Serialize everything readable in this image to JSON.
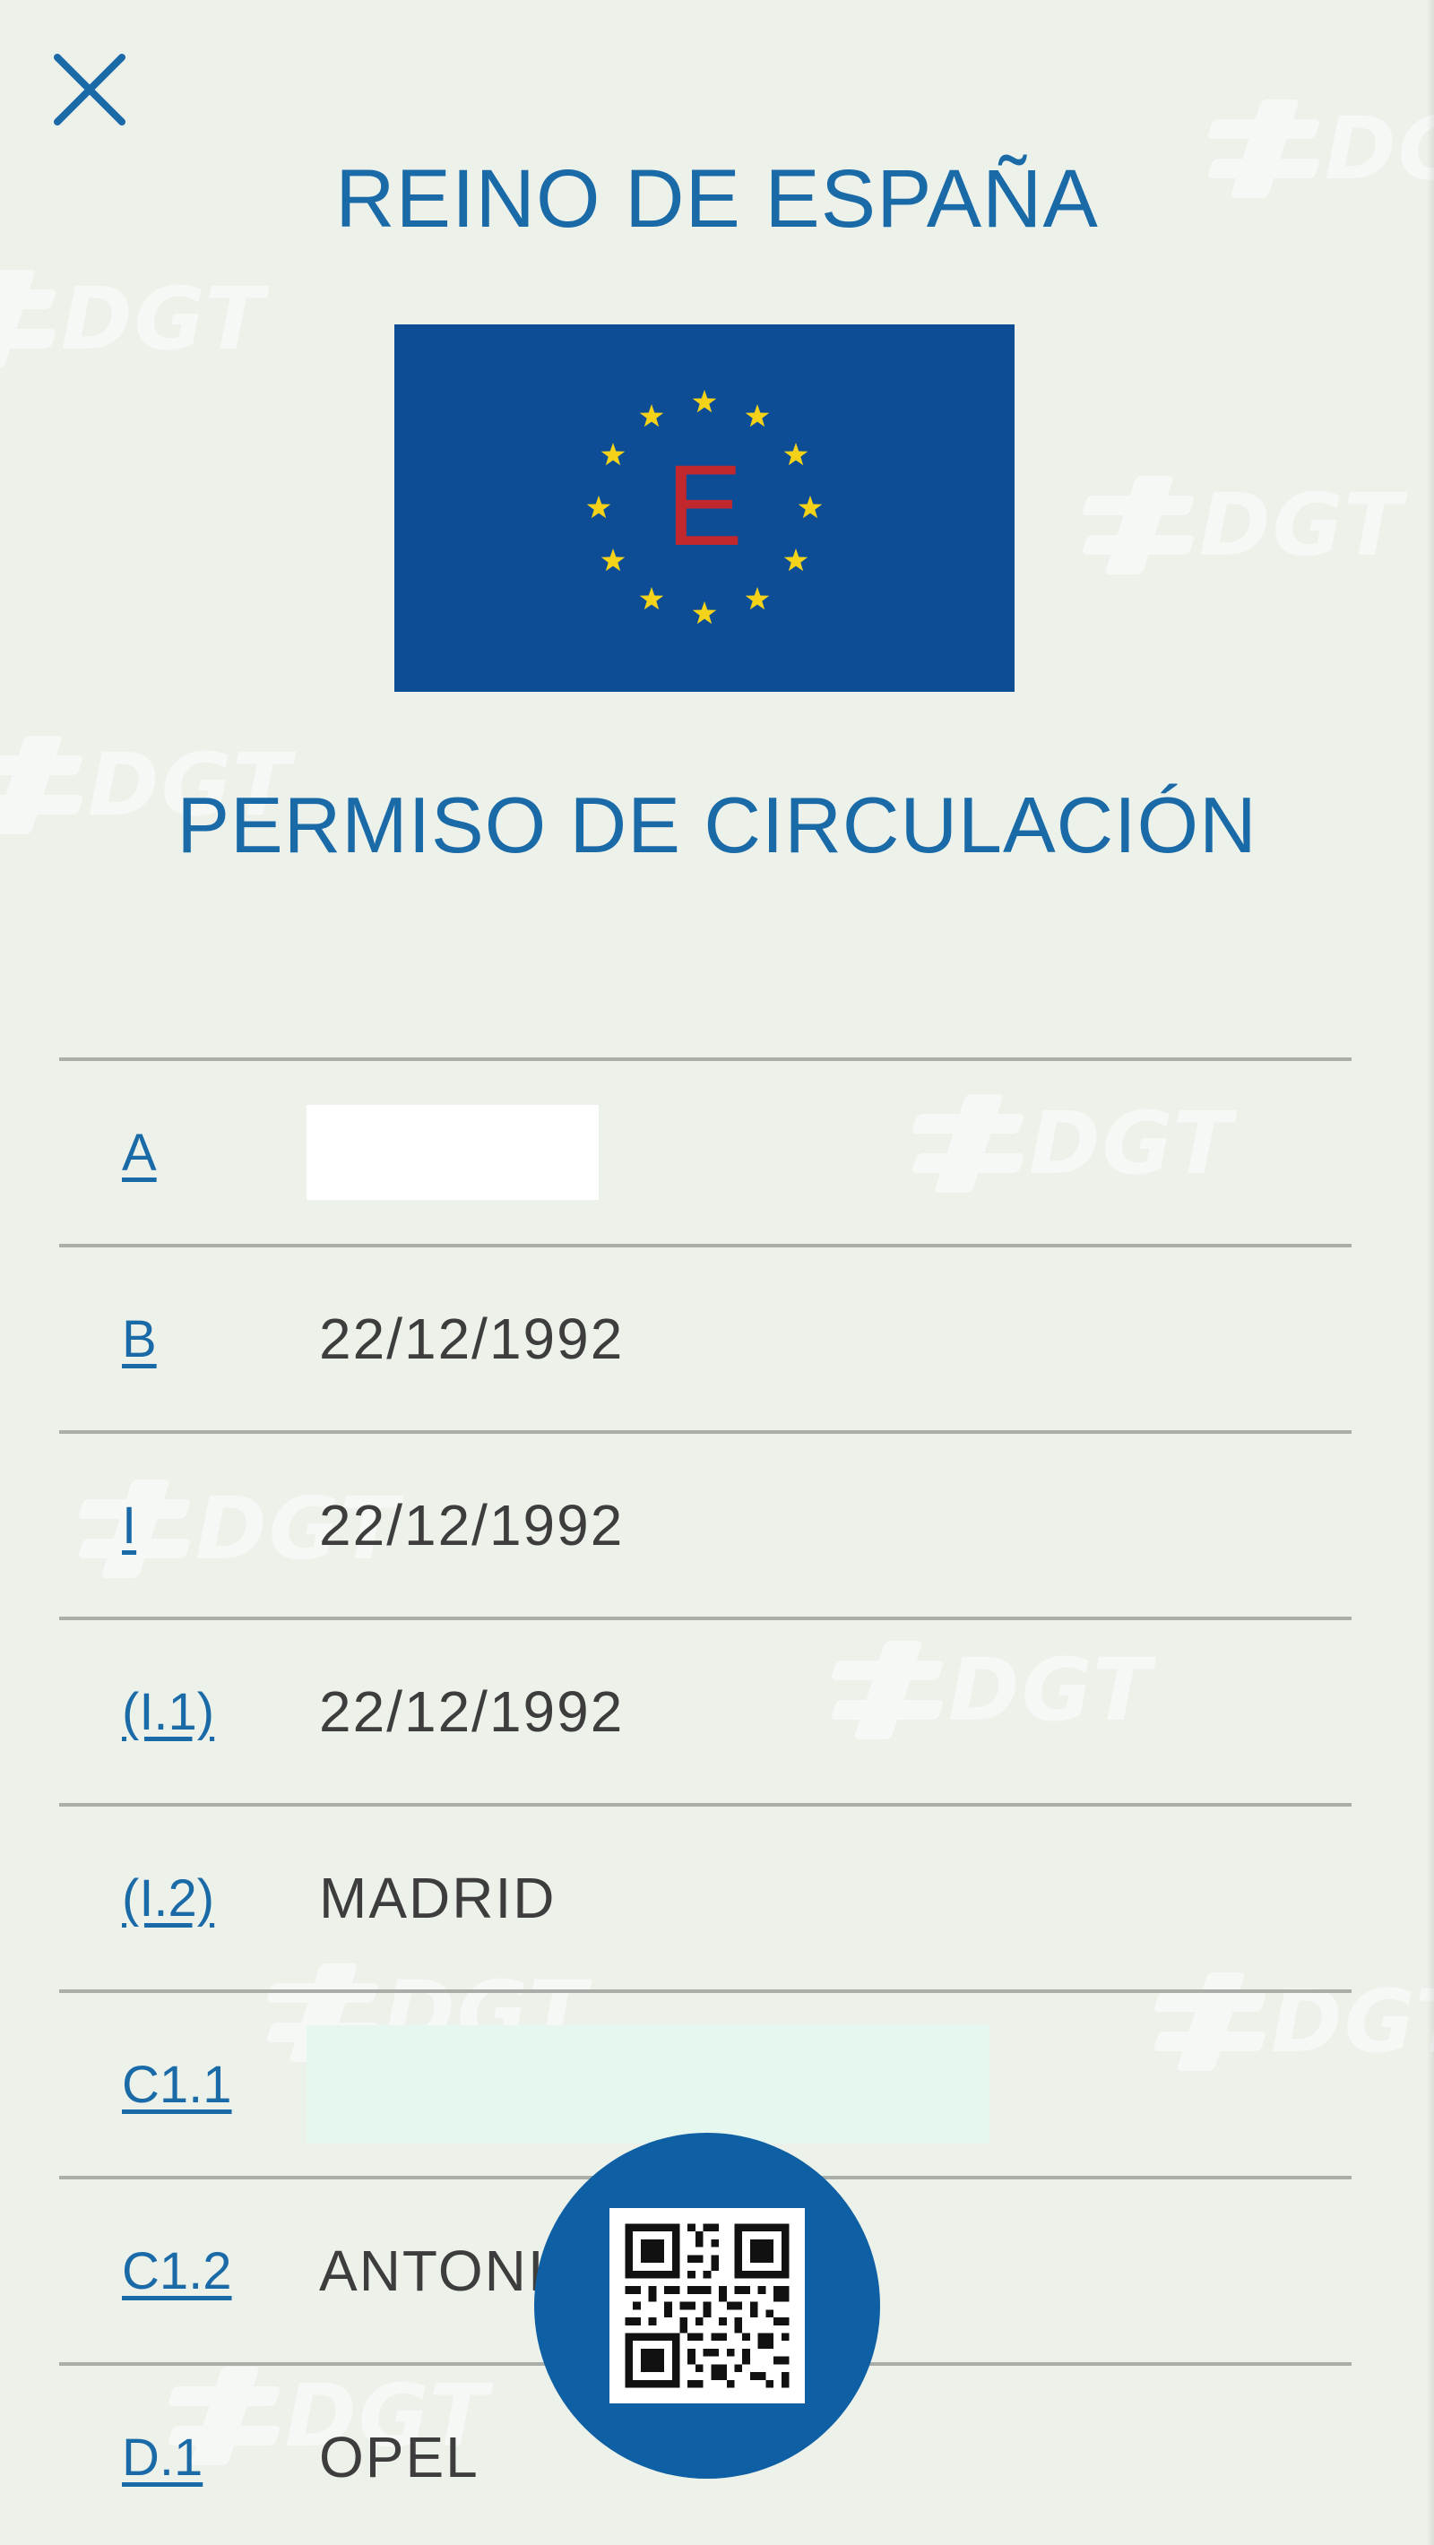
{
  "header": {
    "country": "REINO DE ESPAÑA",
    "flag_letter": "E",
    "document_title": "PERMISO DE CIRCULACIÓN"
  },
  "watermark": {
    "text": "DGT"
  },
  "fields": [
    {
      "label": "A",
      "value": "",
      "redacted": true
    },
    {
      "label": "B",
      "value": "22/12/1992"
    },
    {
      "label": "I",
      "value": "22/12/1992"
    },
    {
      "label": "(I.1)",
      "value": "22/12/1992"
    },
    {
      "label": "(I.2)",
      "value": "MADRID"
    },
    {
      "label": "C1.1",
      "value": "",
      "redacted": true
    },
    {
      "label": "C1.2",
      "value": "ANTONI"
    },
    {
      "label": "D.1",
      "value": "OPEL"
    }
  ],
  "colors": {
    "background": "#ecf1ea",
    "accent": "#1a6aa8",
    "flag_blue": "#0d4d96",
    "flag_stars": "#f5d21a",
    "flag_letter": "#c0282d",
    "fab": "#0e5fa3",
    "value_text": "#3d3d3d"
  },
  "icons": {
    "close": "close-icon",
    "qr": "qr-code-icon"
  }
}
